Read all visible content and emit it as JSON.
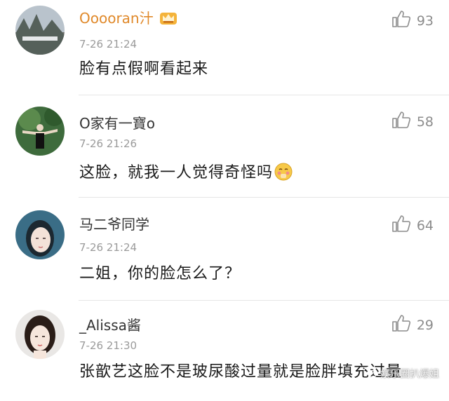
{
  "comments": [
    {
      "username": "Ooooran汁",
      "time": "7-26 21:24",
      "text": "脸有点假啊看起来",
      "likes": "93"
    },
    {
      "username": "O家有一寶o",
      "time": "7-26 21:26",
      "text": "这脸，就我一人觉得奇怪吗",
      "likes": "58"
    },
    {
      "username": "马二爷同学",
      "time": "7-26 21:24",
      "text": "二姐，你的脸怎么了？",
      "likes": "64"
    },
    {
      "username": "_Alissa酱",
      "time": "7-26 21:30",
      "text": "张歆艺这脸不是玻尿酸过量就是脸胖填充过量",
      "likes": "29"
    }
  ],
  "watermark": {
    "text": "娱乐圈扒爆姐"
  },
  "colors": {
    "vip_name": "#e0892a",
    "meta": "#9a9a9a",
    "divider": "#e6e6e6"
  },
  "icons": {
    "like": "thumbs-up-icon",
    "vip": "crown-badge-icon",
    "emoji": "shy-emoji-icon"
  }
}
